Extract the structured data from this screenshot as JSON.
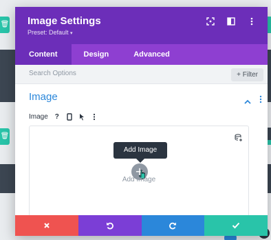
{
  "modal": {
    "title": "Image Settings",
    "preset": "Preset: Default",
    "tabs": [
      {
        "label": "Content",
        "active": true
      },
      {
        "label": "Design",
        "active": false
      },
      {
        "label": "Advanced",
        "active": false
      }
    ],
    "search": {
      "placeholder": "Search Options"
    },
    "filter_label": "+ Filter",
    "section_title": "Image",
    "field_label": "Image",
    "tooltip": "Add Image",
    "upload_label": "Add Image"
  },
  "colors": {
    "header": "#6c2eb9",
    "tabs": "#8e3fd1",
    "section_title": "#2b87da",
    "discard": "#ef5350",
    "undo": "#7b3ed6",
    "redo": "#2b87da",
    "save": "#29c4a9"
  },
  "icons": {
    "header": [
      "fullscreen-icon",
      "split-view-icon",
      "more-vertical-icon"
    ],
    "field": [
      "help-icon",
      "mobile-icon",
      "cursor-icon",
      "more-vertical-icon"
    ],
    "footer": [
      "close-icon",
      "undo-icon",
      "redo-icon",
      "check-icon"
    ]
  }
}
